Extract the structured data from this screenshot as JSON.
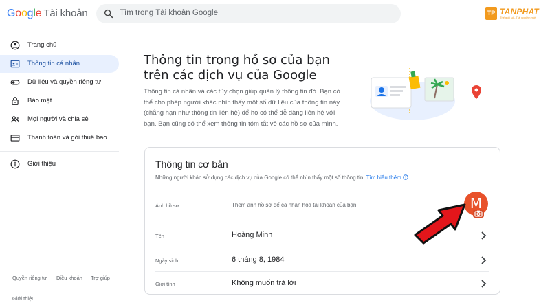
{
  "header": {
    "logo": {
      "letters": [
        "G",
        "o",
        "o",
        "g",
        "l",
        "e"
      ],
      "product": "Tài khoản"
    },
    "search": {
      "placeholder": "Tìm trong Tài khoản Google"
    },
    "brand": {
      "mark": "TP",
      "name": "TANPHAT",
      "tagline": "Thế giới số - Trải nghiệm mới"
    }
  },
  "sidebar": {
    "items": [
      {
        "label": "Trang chủ",
        "icon": "home-circle-icon",
        "active": false
      },
      {
        "label": "Thông tin cá nhân",
        "icon": "id-card-icon",
        "active": true
      },
      {
        "label": "Dữ liệu và quyền riêng tư",
        "icon": "toggle-icon",
        "active": false
      },
      {
        "label": "Bảo mật",
        "icon": "lock-icon",
        "active": false
      },
      {
        "label": "Mọi người và chia sẻ",
        "icon": "people-icon",
        "active": false
      },
      {
        "label": "Thanh toán và gói thuê bao",
        "icon": "credit-card-icon",
        "active": false
      },
      {
        "label": "Giới thiệu",
        "icon": "info-icon",
        "active": false
      }
    ],
    "footer": [
      "Quyền riêng tư",
      "Điều khoản",
      "Trợ giúp",
      "Giới thiệu"
    ]
  },
  "main": {
    "title": "Thông tin trong hồ sơ của bạn trên các dịch vụ của Google",
    "description": "Thông tin cá nhân và các tùy chọn giúp quản lý thông tin đó. Bạn có thể cho phép người khác nhìn thấy một số dữ liệu của thông tin này (chẳng hạn như thông tin liên hệ) để họ có thể dễ dàng liên hệ với bạn. Bạn cũng có thể xem thông tin tóm tắt về các hồ sơ của mình.",
    "card": {
      "title": "Thông tin cơ bản",
      "subtitle": "Những người khác sử dụng các dịch vụ của Google có thể nhìn thấy một số thông tin.",
      "learn_more": "Tìm hiểu thêm",
      "photo": {
        "label": "Ảnh hồ sơ",
        "hint": "Thêm ảnh hồ sơ để cá nhân hóa tài khoản của bạn",
        "initial": "M"
      },
      "rows": [
        {
          "label": "Tên",
          "value": "Hoàng Minh"
        },
        {
          "label": "Ngày sinh",
          "value": "6 tháng 8, 1984"
        },
        {
          "label": "Giới tính",
          "value": "Không muốn trả lời"
        }
      ]
    }
  },
  "colors": {
    "accent": "#1a73e8",
    "active_bg": "#e8f0fe",
    "avatar": "#e8512a",
    "arrow": "#e3161b",
    "brand": "#f29a1e"
  }
}
